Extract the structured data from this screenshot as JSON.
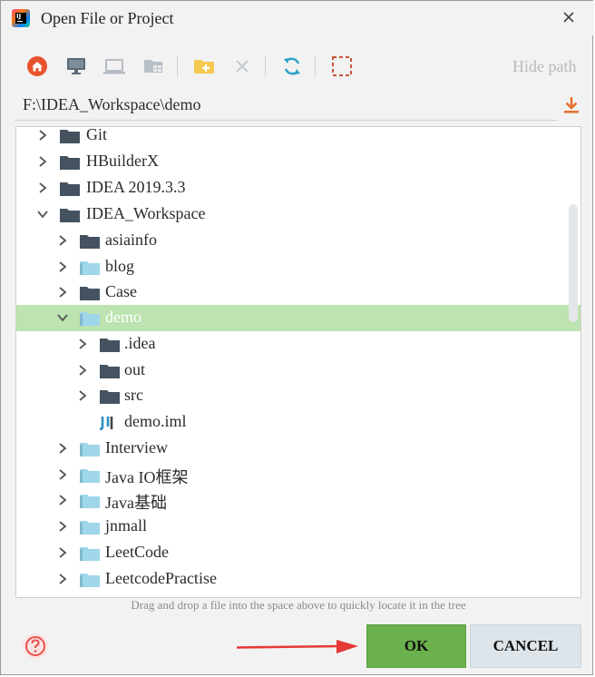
{
  "window": {
    "title": "Open File or Project",
    "app_icon": "intellij-idea-icon",
    "close_icon": "close-icon"
  },
  "toolbar": {
    "buttons": [
      {
        "name": "home-button",
        "icon": "home-icon",
        "enabled": true
      },
      {
        "name": "desktop-button",
        "icon": "desktop-icon",
        "enabled": true
      },
      {
        "name": "laptop-button",
        "icon": "laptop-icon",
        "enabled": false
      },
      {
        "name": "modules-button",
        "icon": "modules-icon",
        "enabled": false
      },
      {
        "name": "new-folder-button",
        "icon": "new-folder-icon",
        "enabled": true
      },
      {
        "name": "delete-button",
        "icon": "delete-icon",
        "enabled": false
      },
      {
        "name": "refresh-button",
        "icon": "refresh-icon",
        "enabled": true
      },
      {
        "name": "select-button",
        "icon": "dashed-square-icon",
        "enabled": true
      }
    ],
    "hide_path_label": "Hide path"
  },
  "path": {
    "value": "F:\\IDEA_Workspace\\demo",
    "download_icon": "download-icon"
  },
  "tree": {
    "selected": "demo",
    "items": [
      {
        "label": "Git",
        "expanded": false,
        "icon": "folder-dark-icon"
      },
      {
        "label": "HBuilderX",
        "expanded": false,
        "icon": "folder-dark-icon"
      },
      {
        "label": "IDEA 2019.3.3",
        "expanded": false,
        "icon": "folder-dark-icon"
      },
      {
        "label": "IDEA_Workspace",
        "expanded": true,
        "icon": "folder-dark-icon"
      },
      {
        "label": "asiainfo",
        "expanded": false,
        "icon": "folder-dark-icon"
      },
      {
        "label": "blog",
        "expanded": false,
        "icon": "project-folder-icon"
      },
      {
        "label": "Case",
        "expanded": false,
        "icon": "folder-dark-icon"
      },
      {
        "label": "demo",
        "expanded": true,
        "icon": "project-folder-icon"
      },
      {
        "label": ".idea",
        "expanded": false,
        "icon": "folder-dark-icon"
      },
      {
        "label": "out",
        "expanded": false,
        "icon": "folder-dark-icon"
      },
      {
        "label": "src",
        "expanded": false,
        "icon": "folder-dark-icon"
      },
      {
        "label": "demo.iml",
        "expanded": null,
        "icon": "iml-file-icon"
      },
      {
        "label": "Interview",
        "expanded": false,
        "icon": "project-folder-icon"
      },
      {
        "label": "Java IO框架",
        "expanded": false,
        "icon": "project-folder-icon"
      },
      {
        "label": "Java基础",
        "expanded": false,
        "icon": "project-folder-icon"
      },
      {
        "label": "jnmall",
        "expanded": false,
        "icon": "project-folder-icon"
      },
      {
        "label": "LeetCode",
        "expanded": false,
        "icon": "project-folder-icon"
      },
      {
        "label": "LeetcodePractise",
        "expanded": false,
        "icon": "project-folder-icon"
      }
    ]
  },
  "hint": "Drag and drop a file into the space above to quickly locate it in the tree",
  "footer": {
    "help_icon": "help-icon",
    "ok_label": "OK",
    "cancel_label": "CANCEL",
    "annotation": "red-arrow-icon"
  },
  "colors": {
    "selection": "#bce3b0",
    "ok_button": "#6ab04c",
    "cancel_button": "#dde4ea",
    "folder_dark": "#44535f",
    "project_folder": "#9fd6ea",
    "accent_orange": "#e86e2c",
    "arrow_red": "#e53935"
  }
}
